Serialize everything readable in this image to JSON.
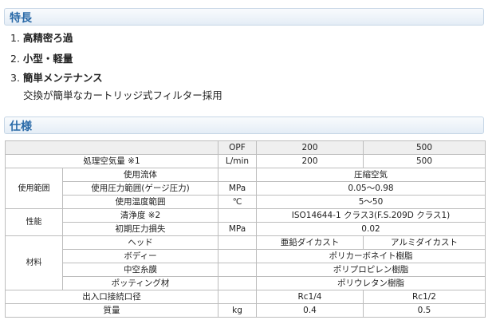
{
  "features": {
    "heading": "特長",
    "items": [
      {
        "num": "1.",
        "text": "高精密ろ過"
      },
      {
        "num": "2.",
        "text": "小型・軽量"
      },
      {
        "num": "3.",
        "text": "簡単メンテナンス"
      }
    ],
    "item3_desc": "交換が簡単なカートリッジ式フィルター採用"
  },
  "specs": {
    "heading": "仕様",
    "header": {
      "model": "OPF",
      "c1": "200",
      "c2": "500"
    },
    "rows": {
      "flow": {
        "label": "処理空気量 ※1",
        "unit": "L/min",
        "v1": "200",
        "v2": "500"
      },
      "usage_group": "使用範囲",
      "fluid": {
        "label": "使用流体",
        "value": "圧縮空気"
      },
      "pressure": {
        "label": "使用圧力範囲(ゲージ圧力)",
        "unit": "MPa",
        "value": "0.05～0.98"
      },
      "temp": {
        "label": "使用温度範囲",
        "unit": "℃",
        "value": "5～50"
      },
      "perf_group": "性能",
      "clean": {
        "label": "清浄度 ※2",
        "value": "ISO14644-1 クラス3(F.S.209D クラス1)"
      },
      "loss": {
        "label": "初期圧力損失",
        "unit": "MPa",
        "value": "0.02"
      },
      "mat_group": "材料",
      "head": {
        "label": "ヘッド",
        "v1": "亜鉛ダイカスト",
        "v2": "アルミダイカスト"
      },
      "body": {
        "label": "ボディー",
        "value": "ポリカーボネイト樹脂"
      },
      "fiber": {
        "label": "中空糸膜",
        "value": "ポリプロピレン樹脂"
      },
      "potting": {
        "label": "ポッティング材",
        "value": "ポリウレタン樹脂"
      },
      "port": {
        "label": "出入口接続口径",
        "v1": "Rc1/4",
        "v2": "Rc1/2"
      },
      "weight": {
        "label": "質量",
        "unit": "kg",
        "v1": "0.4",
        "v2": "0.5"
      }
    }
  }
}
